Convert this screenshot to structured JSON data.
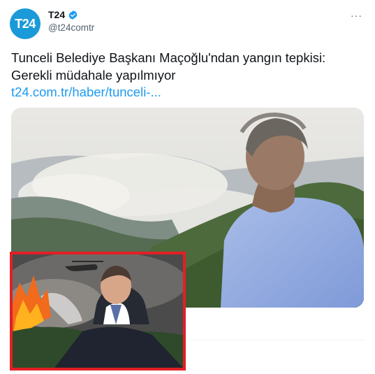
{
  "account": {
    "avatar_text": "T24",
    "display_name": "T24",
    "handle": "@t24comtr",
    "verified": true
  },
  "tweet": {
    "text": "Tunceli Belediye Başkanı Maçoğlu'ndan yangın tepkisi: Gerekli müdahale yapılmıyor",
    "link": "t24.com.tr/haber/tunceli-..."
  },
  "menu": {
    "more_glyph": "···",
    "icon": "more-horizontal-icon"
  },
  "colors": {
    "brand": "#1a9ad8",
    "link": "#1d9bf0",
    "inset_border": "#e21f26"
  }
}
